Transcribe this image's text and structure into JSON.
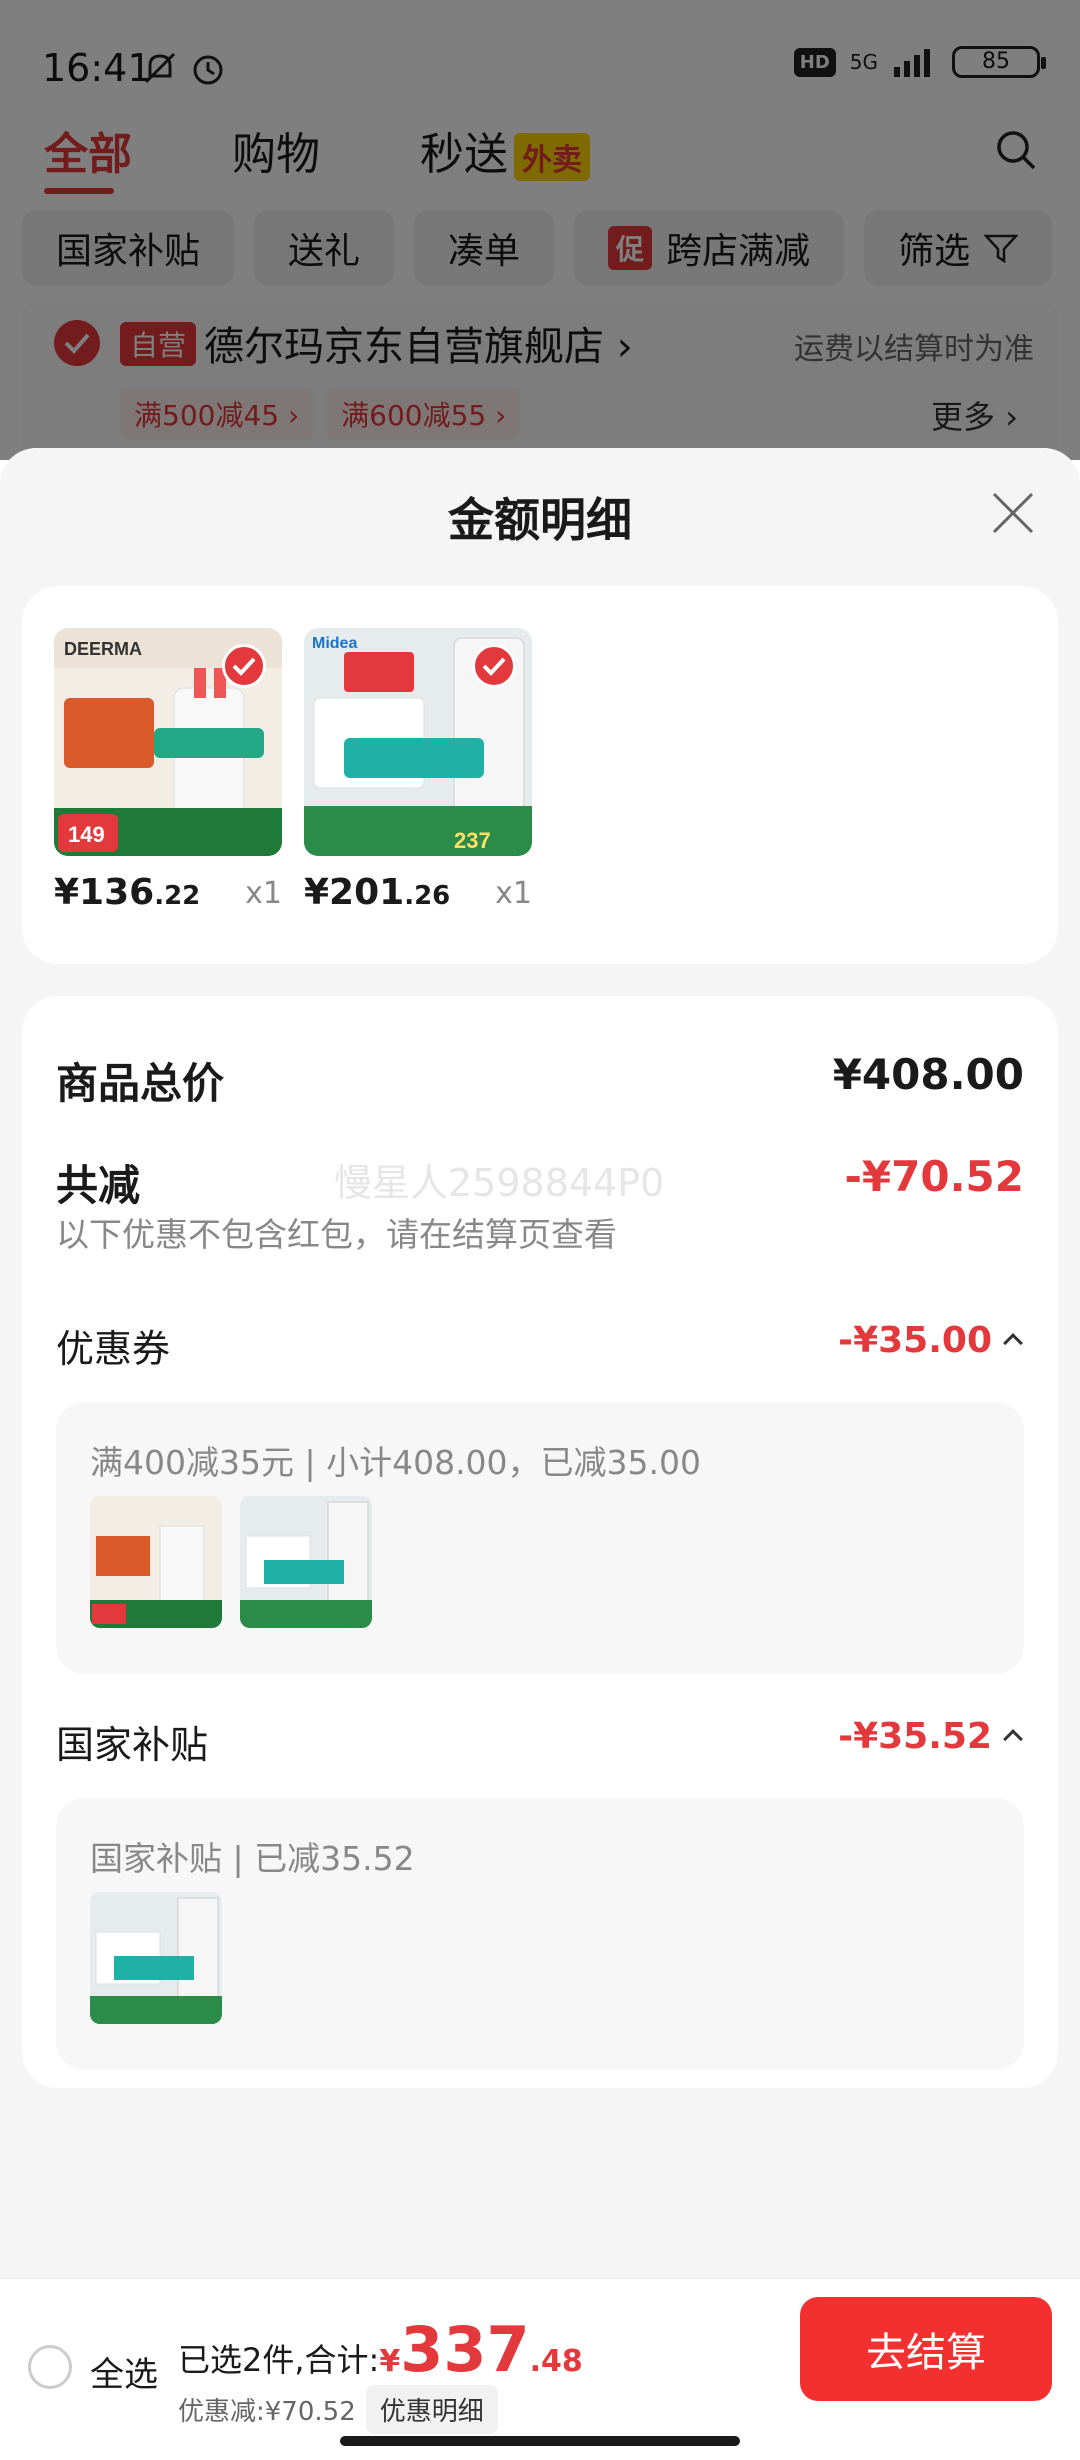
{
  "status_bar": {
    "time": "16:41",
    "hd": "HD",
    "network": "5G",
    "battery": "85"
  },
  "top_tabs": [
    {
      "label": "全部",
      "active": true
    },
    {
      "label": "购物",
      "active": false
    },
    {
      "label": "秒送",
      "active": false
    }
  ],
  "waimai_badge": "外卖",
  "chips": [
    "国家补贴",
    "送礼",
    "凑单",
    "跨店满减",
    "筛选"
  ],
  "cu_badge": "促",
  "store": {
    "badge": "自营",
    "name": "德尔玛京东自营旗舰店 ›",
    "shipping": "运费以结算时为准",
    "promos": [
      "满500减45 ›",
      "满600减55 ›"
    ],
    "more": "更多 ›"
  },
  "sheet": {
    "title": "金额明细",
    "goods": [
      {
        "price_int": "¥136",
        "price_dec": ".22",
        "qty": "x1",
        "brand": "DEERMA",
        "img_badge": "149"
      },
      {
        "price_int": "¥201",
        "price_dec": ".26",
        "qty": "x1",
        "brand": "Midea",
        "img_badge": "237"
      }
    ],
    "total_label": "商品总价",
    "total_value": "¥408.00",
    "discount_label": "共减",
    "discount_value": "-¥70.52",
    "discount_note": "以下优惠不包含红包，请在结算页查看",
    "watermark": "慢星人2598844P0",
    "coupon": {
      "label": "优惠券",
      "amount": "-¥35.00",
      "detail": "满400减35元 | 小计408.00，已减35.00"
    },
    "subsidy": {
      "label": "国家补贴",
      "amount": "-¥35.52",
      "detail": "国家补贴 | 已减35.52"
    }
  },
  "bottom_bar": {
    "select_all": "全选",
    "selected_text": "已选2件,合计:",
    "total_yen": "¥",
    "total_int": "337",
    "total_dec": ".48",
    "discount_text": "优惠减:¥70.52",
    "detail_button": "优惠明细",
    "checkout": "去结算"
  },
  "colors": {
    "accent": "#e4393c",
    "checkout": "#f23030",
    "sheet_bg": "#f5f5f5"
  }
}
